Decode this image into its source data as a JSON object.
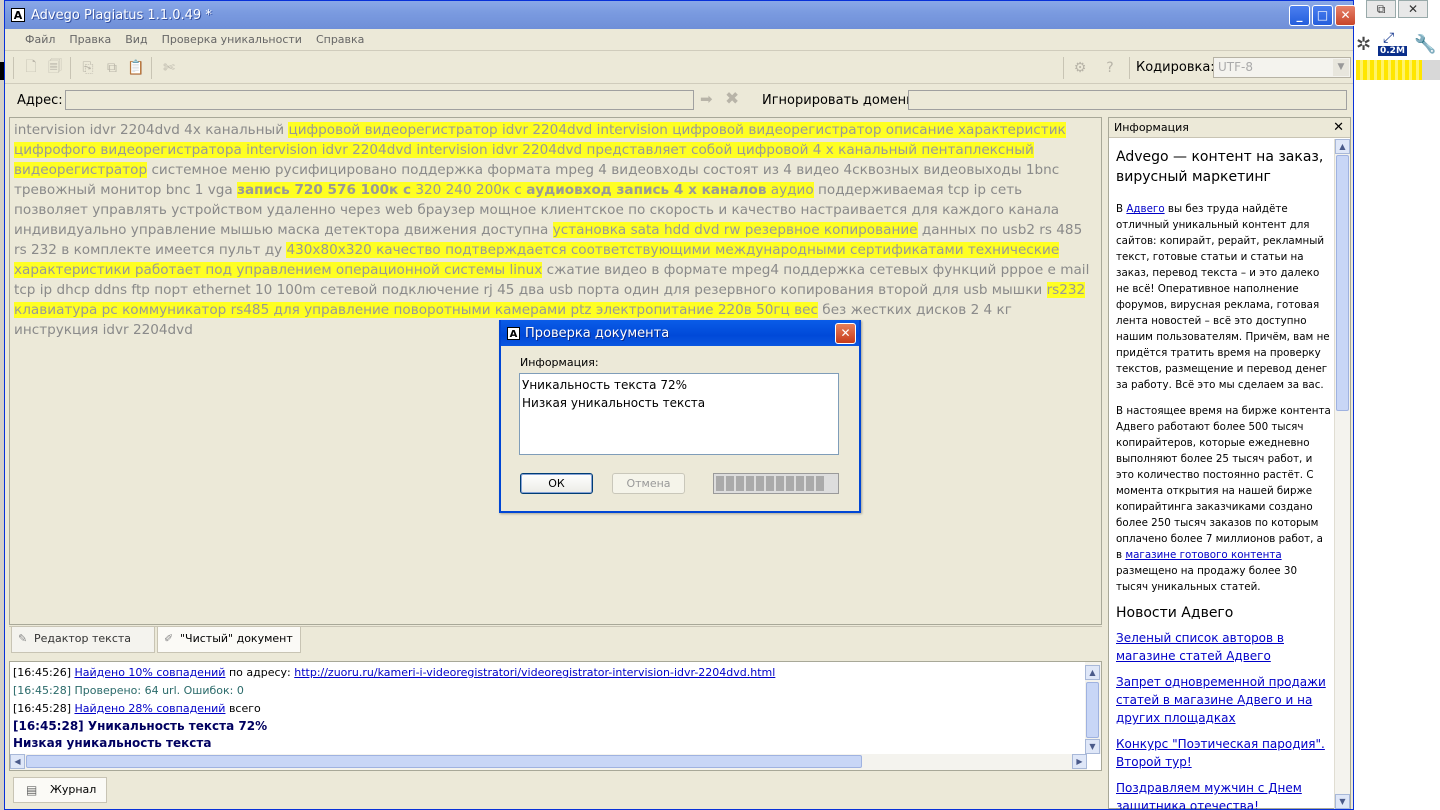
{
  "window": {
    "title": "Advego Plagiatus 1.1.0.49 *",
    "minimize": "_",
    "maximize": "□",
    "close": "✕"
  },
  "menu": [
    "Файл",
    "Правка",
    "Вид",
    "Проверка уникальности",
    "Справка"
  ],
  "toolbar": {
    "encoding_label": "Кодировка:",
    "encoding_value": "UTF-8"
  },
  "address": {
    "label": "Адрес:",
    "value": "",
    "ignore_label": "Игнорировать домены:",
    "ignore_value": ""
  },
  "editor": {
    "segments": [
      {
        "t": "intervision idvr 2204dvd 4x канальный ",
        "h": false
      },
      {
        "t": "цифровой видеорегистратор idvr 2204dvd intervision цифровой видеорегистратор описание характеристик цифрофого видеорегистратора intervision idvr 2204dvd intervision idvr 2204dvd представляет собой цифровой 4 x канальный пентаплексный видеорегистратор",
        "h": true
      },
      {
        "t": " системное меню русифицировано поддержка формата mpeg 4 видеовходы состоят из 4 видео 4сквозных видеовыходы 1bnc тревожный монитор bnc 1 vga ",
        "h": false
      },
      {
        "t": "запись 720 576 100к с",
        "h": true,
        "b": true
      },
      {
        "t": " 320 240 200к с ",
        "h": true
      },
      {
        "t": "аудиовход запись 4 x каналов",
        "h": true,
        "b": true
      },
      {
        "t": " аудио",
        "h": true
      },
      {
        "t": " поддерживаемая tcp ip сеть позволяет управлять устройством удаленно через web браузер мощное клиентское по скорость и качество настраивается для каждого канала индивидуально управление мышью маска детектора движения доступна ",
        "h": false
      },
      {
        "t": "установка sata hdd dvd rw резервное копирование",
        "h": true
      },
      {
        "t": " данных по usb2 rs 485 rs 232 в комплекте имеется пульт ду ",
        "h": false
      },
      {
        "t": "430x80x320 качество подтверждается соответствующими международными сертификатами технические характеристики работает под управлением операционной системы linux",
        "h": true
      },
      {
        "t": " сжатие видео в формате mpeg4 поддержка сетевых функций pppoe e mail tcp ip dhcp ddns ftp порт ethernet 10 100m сетевой подключение rj 45 два usb порта один для резервного копирования второй для usb мышки ",
        "h": false
      },
      {
        "t": "rs232 клавиатура pc коммуникатор rs485 для управление поворотными камерами ptz электропитание 220в 50гц вес",
        "h": true
      },
      {
        "t": " без жестких дисков 2 4 кг инструкция idvr 2204dvd",
        "h": false
      }
    ]
  },
  "editor_tabs": {
    "editor": "Редактор текста",
    "clean": "\"Чистый\" документ"
  },
  "info": {
    "header": "Информация",
    "title": "Advego — контент на заказ, вирусный маркетинг",
    "p1_pre": "В ",
    "p1_link": "Адвего",
    "p1_post": " вы без труда найдёте отличный уникальный контент для сайтов: копирайт, рерайт, рекламный текст, готовые статьи и статьи на заказ, перевод текста – и это далеко не всё! Оперативное наполнение форумов, вирусная реклама, готовая лента новостей – всё это доступно нашим пользователям. Причём, вам не придётся тратить время на проверку текстов, размещение и перевод денег за работу. Всё это мы сделаем за вас.",
    "p2_pre": "В настоящее время на бирже контента Адвего работают более 500 тысяч копирайтеров, которые ежедневно выполняют более 25 тысяч работ, и это количество постоянно растёт. С момента открытия на нашей бирже копирайтинга заказчиками создано более 250 тысяч заказов по которым оплачено более 7 миллионов работ, а в ",
    "p2_link": "магазине готового контента",
    "p2_post": " размещено на продажу более 30 тысяч уникальных статей.",
    "news_title": "Новости Адвего",
    "news": [
      "Зеленый список авторов в магазине статей Адвего",
      "Запрет одновременной продажи статей в магазине Адвего и на других площадках",
      "Конкурс \"Поэтическая пародия\". Второй тур!",
      "Поздравляем мужчин с Днем защитника отечества! Специальные марки!"
    ]
  },
  "log": {
    "l1_time": "[16:45:26] ",
    "l1_link": "Найдено 10% совпадений",
    "l1_mid": " по адресу: ",
    "l1_url": "http://zuoru.ru/kameri-i-videoregistratori/videoregistrator-intervision-idvr-2204dvd.html",
    "l2": "[16:45:28] Проверено: 64 url. Ошибок: 0",
    "l3_time": "[16:45:28] ",
    "l3_link": "Найдено 28% совпадений",
    "l3_post": " всего",
    "l4": "[16:45:28] Уникальность текста 72%",
    "l5": "Низкая уникальность текста",
    "tab": "Журнал"
  },
  "dialog": {
    "title": "Проверка документа",
    "label": "Информация:",
    "line1": "Уникальность текста 72%",
    "line2": "Низкая уникальность текста",
    "ok": "ОК",
    "cancel": "Отмена",
    "progress": 0.9
  },
  "colors": {
    "highlight": "#ffff22",
    "link": "#0000c8",
    "dialog_title": "#0049d8"
  }
}
